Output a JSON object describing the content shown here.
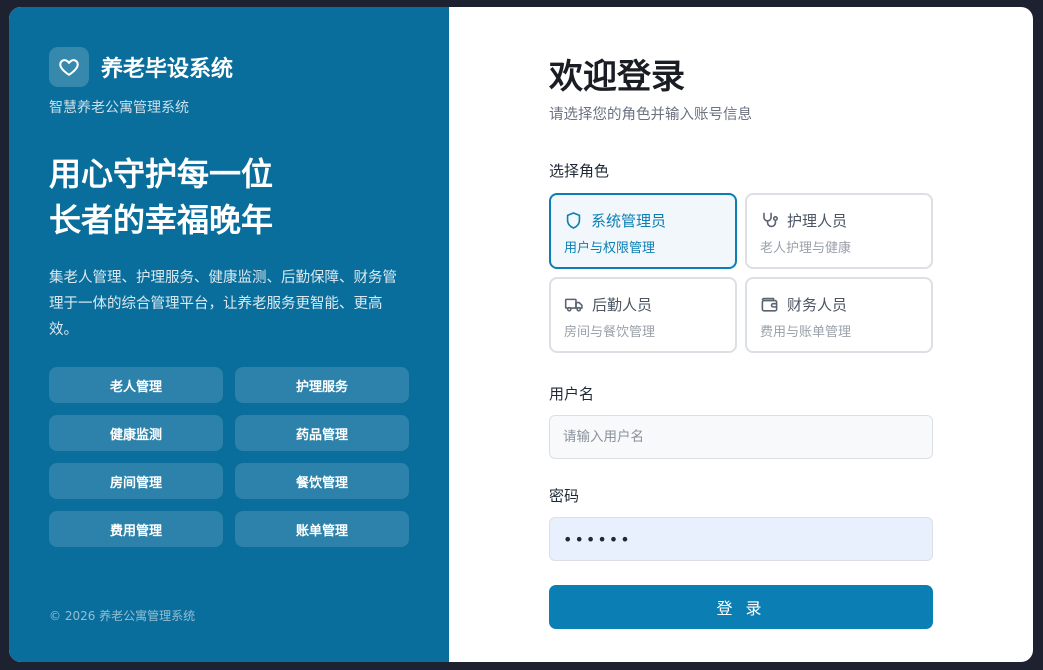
{
  "brand": {
    "icon": "heart-icon",
    "title": "养老毕设系统",
    "subtitle": "智慧养老公寓管理系统"
  },
  "hero": {
    "line1": "用心守护每一位",
    "line2": "长者的幸福晚年",
    "description": "集老人管理、护理服务、健康监测、后勤保障、财务管理于一体的综合管理平台，让养老服务更智能、更高效。"
  },
  "features": [
    "老人管理",
    "护理服务",
    "健康监测",
    "药品管理",
    "房间管理",
    "餐饮管理",
    "费用管理",
    "账单管理"
  ],
  "copyright": "© 2026 养老公寓管理系统",
  "login": {
    "title": "欢迎登录",
    "subtitle": "请选择您的角色并输入账号信息",
    "role_label": "选择角色",
    "roles": [
      {
        "name": "系统管理员",
        "desc": "用户与权限管理",
        "icon": "shield-icon",
        "selected": true
      },
      {
        "name": "护理人员",
        "desc": "老人护理与健康",
        "icon": "stethoscope-icon",
        "selected": false
      },
      {
        "name": "后勤人员",
        "desc": "房间与餐饮管理",
        "icon": "truck-icon",
        "selected": false
      },
      {
        "name": "财务人员",
        "desc": "费用与账单管理",
        "icon": "wallet-icon",
        "selected": false
      }
    ],
    "username_label": "用户名",
    "username_placeholder": "请输入用户名",
    "username_value": "",
    "password_label": "密码",
    "password_value": "••••••",
    "submit_label": "登 录"
  },
  "colors": {
    "left_panel": "#0a6e9c",
    "accent": "#0b7fb3",
    "role_border": "#dcdfe4",
    "password_bg": "#e8f0fe"
  }
}
